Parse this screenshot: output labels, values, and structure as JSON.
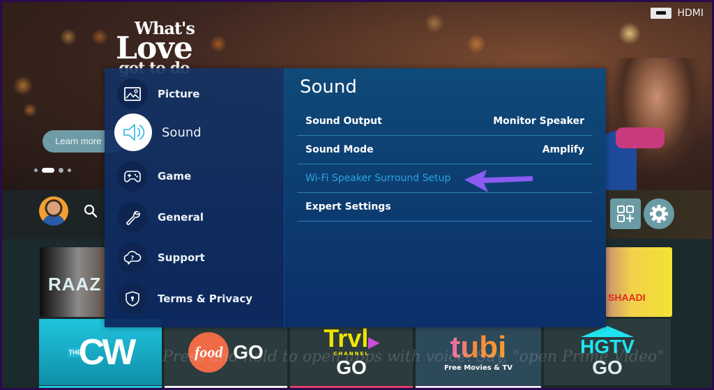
{
  "source": {
    "label": "HDMI",
    "icon": "hdmi-port-icon"
  },
  "hero": {
    "title_lines": [
      "What's",
      "Love",
      "got to do"
    ],
    "learn_more_label": "Learn more",
    "carousel": {
      "total": 4,
      "active_index": 1
    }
  },
  "home_nav": {
    "avatar": "profile-avatar",
    "search_icon": "search-icon",
    "apps_icon": "apps-grid-icon",
    "settings_icon": "gear-icon"
  },
  "content_row": {
    "left_tile_title": "RAAZ",
    "right_tile_title": "SHAADI"
  },
  "apps": [
    {
      "name": "The CW",
      "logo_text": "CW",
      "logo_prefix": "THE"
    },
    {
      "name": "Food Network GO",
      "logo_text": "food",
      "suffix": "GO"
    },
    {
      "name": "Travel Channel GO",
      "logo_text": "Trvl",
      "sub": "CHANNEL",
      "suffix": "GO"
    },
    {
      "name": "Tubi",
      "logo_text": "tubi",
      "sub": "Free Movies & TV"
    },
    {
      "name": "HGTV GO",
      "logo_text": "HGTV",
      "suffix": "GO"
    }
  ],
  "voice_hint": "Press and hold to open apps with voice. Say, \"open Prime Video\"",
  "settings": {
    "categories": [
      {
        "label": "Picture",
        "icon": "picture-icon",
        "selected": false
      },
      {
        "label": "Sound",
        "icon": "speaker-icon",
        "selected": true
      },
      {
        "label": "Game",
        "icon": "gamepad-icon",
        "selected": false
      },
      {
        "label": "General",
        "icon": "wrench-icon",
        "selected": false
      },
      {
        "label": "Support",
        "icon": "cloud-question-icon",
        "selected": false
      },
      {
        "label": "Terms & Privacy",
        "icon": "shield-lock-icon",
        "selected": false
      }
    ],
    "panel_title": "Sound",
    "rows": [
      {
        "label": "Sound Output",
        "value": "Monitor Speaker"
      },
      {
        "label": "Sound Mode",
        "value": "Amplify"
      },
      {
        "label": "Wi-Fi Speaker Surround Setup",
        "value": "",
        "highlighted": true
      },
      {
        "label": "Expert Settings",
        "value": ""
      }
    ],
    "accent_color": "#2aa6e0",
    "annotation_color": "#8a5cf0"
  }
}
